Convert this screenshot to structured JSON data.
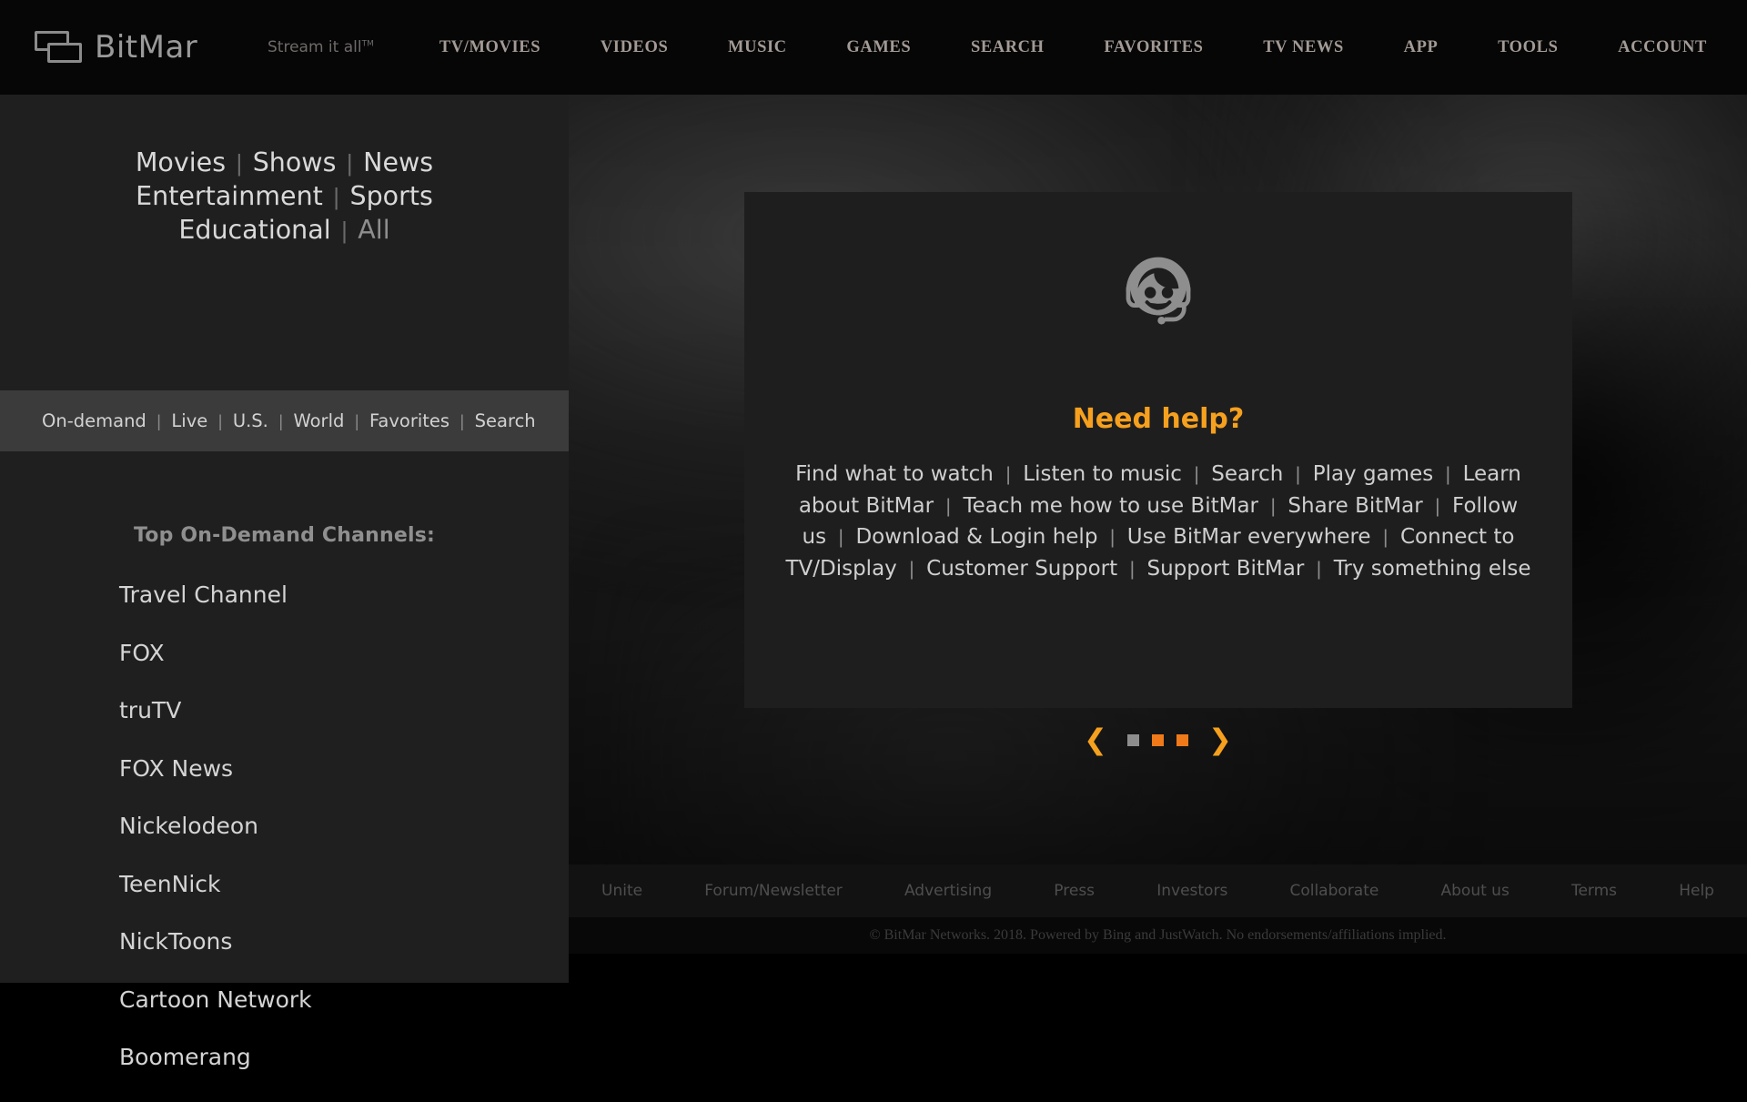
{
  "brand": {
    "name": "BitMar",
    "tagline": "Stream it all",
    "tagline_tm": "TM",
    "logo_icon": "bitmar-rectangles-logo"
  },
  "topnav": {
    "items": [
      {
        "label": "TV/MOVIES"
      },
      {
        "label": "VIDEOS"
      },
      {
        "label": "MUSIC"
      },
      {
        "label": "GAMES"
      },
      {
        "label": "SEARCH"
      },
      {
        "label": "FAVORITES"
      },
      {
        "label": "TV NEWS"
      },
      {
        "label": "APP"
      },
      {
        "label": "TOOLS"
      },
      {
        "label": "ACCOUNT"
      }
    ]
  },
  "sidebar": {
    "categories": [
      {
        "label": "Movies",
        "dim": false
      },
      {
        "label": "Shows",
        "dim": false
      },
      {
        "label": "News",
        "dim": false
      },
      {
        "label": "Entertainment",
        "dim": false
      },
      {
        "label": "Sports",
        "dim": false
      },
      {
        "label": "Educational",
        "dim": false
      },
      {
        "label": "All",
        "dim": true
      }
    ],
    "subnav": [
      {
        "label": "On-demand"
      },
      {
        "label": "Live"
      },
      {
        "label": "U.S."
      },
      {
        "label": "World"
      },
      {
        "label": "Favorites"
      },
      {
        "label": "Search"
      }
    ],
    "channels_title": "Top On-Demand Channels:",
    "channels": [
      {
        "label": "Travel Channel"
      },
      {
        "label": "FOX"
      },
      {
        "label": "truTV"
      },
      {
        "label": "FOX News"
      },
      {
        "label": "Nickelodeon"
      },
      {
        "label": "TeenNick"
      },
      {
        "label": "NickToons"
      },
      {
        "label": "Cartoon Network"
      },
      {
        "label": "Boomerang"
      }
    ]
  },
  "help_panel": {
    "icon": "support-agent-headset-icon",
    "title": "Need help?",
    "links": [
      {
        "label": "Find what to watch"
      },
      {
        "label": "Listen to music"
      },
      {
        "label": "Search"
      },
      {
        "label": "Play games"
      },
      {
        "label": "Learn about BitMar"
      },
      {
        "label": "Teach me how to use BitMar"
      },
      {
        "label": "Share BitMar"
      },
      {
        "label": "Follow us"
      },
      {
        "label": "Download & Login help"
      },
      {
        "label": "Use BitMar everywhere"
      },
      {
        "label": "Connect to TV/Display"
      },
      {
        "label": "Customer Support"
      },
      {
        "label": "Support BitMar"
      },
      {
        "label": "Try something else"
      }
    ]
  },
  "carousel": {
    "prev_icon": "chevron-left-icon",
    "next_icon": "chevron-right-icon",
    "dots": [
      {
        "state": "off"
      },
      {
        "state": "on"
      },
      {
        "state": "on"
      }
    ],
    "accent_color": "#f5a01e",
    "dot_active_color": "#f07a1a",
    "dot_inactive_color": "#8d8d8d"
  },
  "footer": {
    "links": [
      {
        "label": "Unite"
      },
      {
        "label": "Forum/Newsletter"
      },
      {
        "label": "Advertising"
      },
      {
        "label": "Press"
      },
      {
        "label": "Investors"
      },
      {
        "label": "Collaborate"
      },
      {
        "label": "About us"
      },
      {
        "label": "Terms"
      },
      {
        "label": "Help"
      }
    ],
    "copyright": "© BitMar Networks. 2018. Powered by Bing and JustWatch. No endorsements/affiliations implied."
  }
}
